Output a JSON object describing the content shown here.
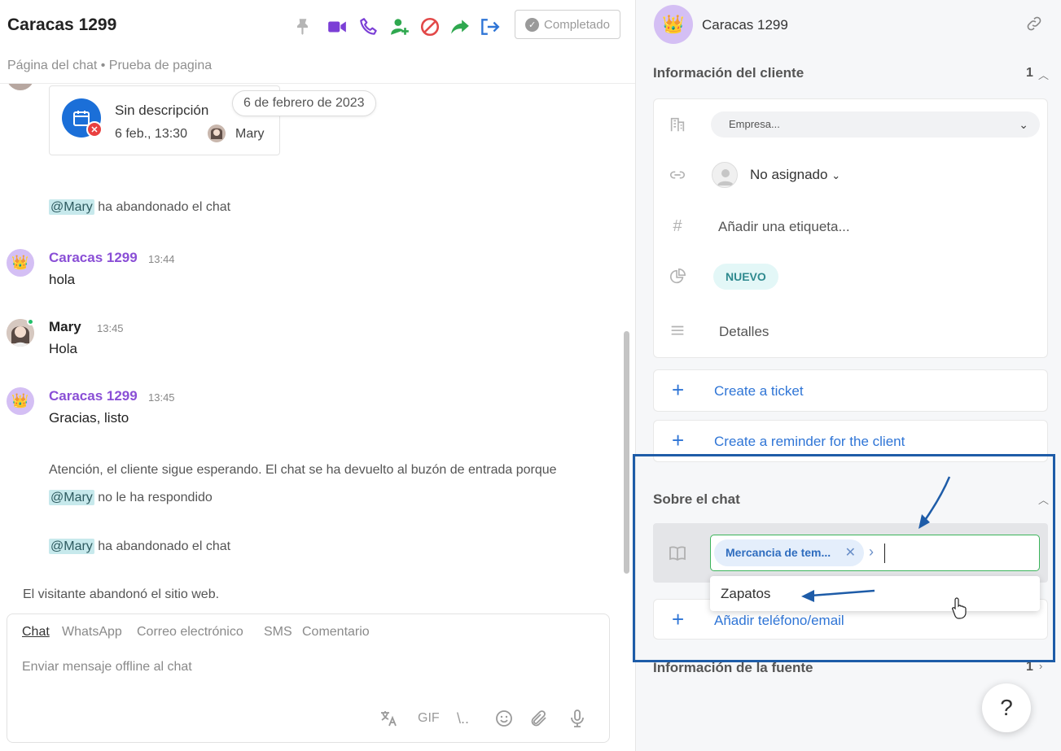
{
  "chat": {
    "title": "Caracas 1299",
    "subtitle": "Página del chat • Prueba de pagina",
    "status_button": "Completado",
    "event": {
      "description": "Sin descripción",
      "time": "6 feb., 13:30",
      "user": "Mary"
    },
    "date_pill": "6 de febrero de 2023",
    "messages": [
      {
        "mention": "@Mary",
        "text": " ha abandonado el chat"
      },
      {
        "name": "Caracas 1299",
        "time": "13:44",
        "text": "hola"
      },
      {
        "name": "Mary",
        "time": "13:45",
        "text": "Hola"
      },
      {
        "name": "Caracas 1299",
        "time": "13:45",
        "text": "Gracias, listo"
      },
      {
        "line1": "Atención, el cliente sigue esperando. El chat se ha devuelto al buzón de entrada porque",
        "mention": "@Mary",
        "line2": " no le ha respondido"
      },
      {
        "mention": "@Mary",
        "text": " ha abandonado el chat"
      },
      {
        "text": "El visitante abandonó el sitio web."
      }
    ]
  },
  "composer": {
    "tabs": [
      "Chat",
      "WhatsApp",
      "Correo electrónico",
      "SMS",
      "Comentario"
    ],
    "active_tab": "Chat",
    "placeholder": "Enviar mensaje offline al chat",
    "gif_label": "GIF",
    "slash_label": "\\.."
  },
  "sidebar": {
    "client_name": "Caracas 1299",
    "client_info": {
      "title": "Información del cliente",
      "count": "1",
      "company_placeholder": "Empresa...",
      "assignee": "No asignado",
      "tag_placeholder": "Añadir una etiqueta...",
      "status": "NUEVO",
      "details": "Detalles"
    },
    "create_ticket": "Create a ticket",
    "create_reminder": "Create a reminder for the client",
    "about_chat": {
      "title": "Sobre el chat",
      "topic_chip": "Mercancia de tem...",
      "dropdown_option": "Zapatos",
      "add_contact": "Añadir teléfono/email"
    },
    "source_info": {
      "title": "Información de la fuente",
      "count": "1"
    }
  },
  "help_label": "?",
  "colors": {
    "accent_blue": "#2f75d6",
    "client_purple": "#8a4fd6",
    "highlight_border": "#1e5ca8",
    "focus_green": "#3bb45a",
    "status_teal": "#2f8a8f"
  }
}
